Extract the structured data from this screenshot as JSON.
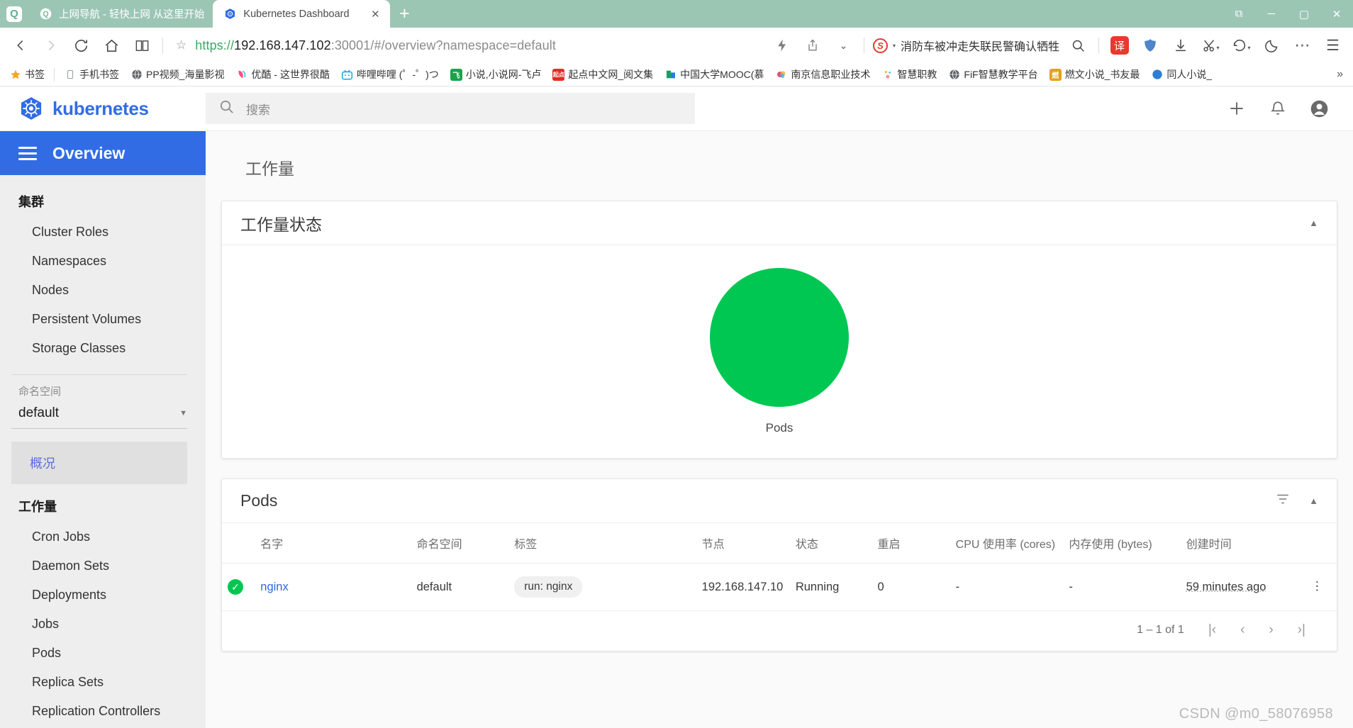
{
  "browser": {
    "tabs": [
      {
        "title": "上网导航 - 轻快上网 从这里开始",
        "icon": "q-logo-icon",
        "active": false
      },
      {
        "title": "Kubernetes Dashboard",
        "icon": "kubernetes-favicon",
        "active": true
      }
    ],
    "new_tab_label": "+",
    "window_controls": {
      "restore_panel": "⧉",
      "minimize": "─",
      "maximize": "▢",
      "close": "✕"
    },
    "toolbar": {
      "back": "‹",
      "forward": "›",
      "reload": "⟳",
      "home": "⌂",
      "reader": "📖",
      "star": "☆",
      "url": {
        "scheme": "https://",
        "host": "192.168.147.102",
        "rest": ":30001/#/overview?namespace=default"
      },
      "flash": "⚡",
      "share": "⇪",
      "chevron": "⌄",
      "news_text": "消防车被冲走失联民警确认牺牲",
      "news_badge": "S",
      "search": "🔍",
      "translate": "译",
      "shield": "🛡",
      "download": "⬇",
      "scissors": "✂",
      "undo": "↺",
      "moon": "☾",
      "more": "⋯",
      "menu": "☰"
    },
    "bookmarks": [
      {
        "label": "书签",
        "icon": "star-icon",
        "color": "#f5a623"
      },
      {
        "label": "手机书签",
        "icon": "phone-icon",
        "color": "#9aa0a6"
      },
      {
        "label": "PP视频_海量影视",
        "icon": "globe-icon",
        "color": "#5f6368"
      },
      {
        "label": "优酷 - 这世界很酷",
        "icon": "youku-icon",
        "color": "#ff4d88"
      },
      {
        "label": "哔哩哔哩 (゜-゜)つ",
        "icon": "bilibili-icon",
        "color": "#00a1d6"
      },
      {
        "label": "小说,小说网-飞卢",
        "icon": "feilu-icon",
        "color": "#1aa34a"
      },
      {
        "label": "起点中文网_阅文集",
        "icon": "qidian-icon",
        "color": "#e32b26"
      },
      {
        "label": "中国大学MOOC(慕",
        "icon": "mooc-icon",
        "color": "#17a05e"
      },
      {
        "label": "南京信息职业技术",
        "icon": "njcit-icon",
        "color": "#e0517a"
      },
      {
        "label": "智慧职教",
        "icon": "icve-icon",
        "color": "#e84c3d"
      },
      {
        "label": "FiF智慧教学平台",
        "icon": "globe-icon",
        "color": "#5f6368"
      },
      {
        "label": "燃文小说_书友最",
        "icon": "ranwen-icon",
        "color": "#e3a21a"
      },
      {
        "label": "同人小说_",
        "icon": "tongren-icon",
        "color": "#2d7fd3"
      }
    ],
    "bookmarks_overflow": "»"
  },
  "app": {
    "logo_text": "kubernetes",
    "search_placeholder": "搜索",
    "top_actions": {
      "add": "+",
      "notifications": "bell-icon",
      "account": "account-icon"
    },
    "page_title": "Overview",
    "sidebar": {
      "cluster_group": "集群",
      "cluster_items": [
        "Cluster Roles",
        "Namespaces",
        "Nodes",
        "Persistent Volumes",
        "Storage Classes"
      ],
      "namespace_label": "命名空间",
      "namespace_value": "default",
      "overview_item": "概况",
      "workload_group": "工作量",
      "workload_items": [
        "Cron Jobs",
        "Daemon Sets",
        "Deployments",
        "Jobs",
        "Pods",
        "Replica Sets",
        "Replication Controllers"
      ]
    },
    "main": {
      "heading": "工作量",
      "status_card": {
        "title": "工作量状态",
        "chart_label": "Pods"
      },
      "pods_card": {
        "title": "Pods",
        "columns": [
          "名字",
          "命名空间",
          "标签",
          "节点",
          "状态",
          "重启",
          "CPU 使用率 (cores)",
          "内存使用 (bytes)",
          "创建时间"
        ],
        "rows": [
          {
            "status": "ok",
            "name": "nginx",
            "namespace": "default",
            "labels": "run: nginx",
            "node": "192.168.147.10",
            "state": "Running",
            "restarts": "0",
            "cpu": "-",
            "memory": "-",
            "created": "59 minutes ago",
            "menu": "⋮"
          }
        ],
        "pagination": {
          "count": "1 – 1 of 1",
          "first": "|‹",
          "prev": "‹",
          "next": "›",
          "last": "›|"
        }
      }
    }
  },
  "watermark": "CSDN @m0_58076958",
  "chart_data": {
    "type": "pie",
    "title": "工作量状态",
    "categories": [
      "Pods"
    ],
    "values": [
      1
    ],
    "colors": [
      "#00c752"
    ],
    "legend_position": "bottom",
    "annotations": [
      "Pods"
    ]
  }
}
